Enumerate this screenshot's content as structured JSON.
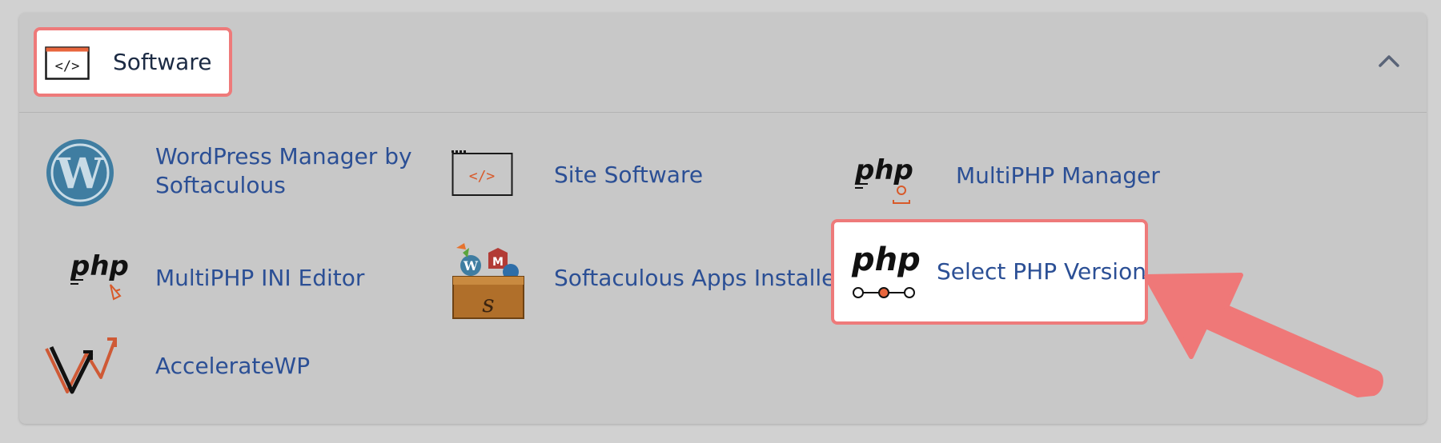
{
  "section": {
    "title": "Software",
    "title_icon": "code-window-icon",
    "collapse_icon": "chevron-up-icon"
  },
  "items": [
    {
      "label_line1": "WordPress Manager by",
      "label_line2": "Softaculous",
      "icon": "wordpress-icon"
    },
    {
      "label": "Site Software",
      "icon": "code-window-icon"
    },
    {
      "label": "MultiPHP Manager",
      "icon": "php-manager-icon"
    },
    {
      "label": "MultiPHP INI Editor",
      "icon": "php-editor-icon"
    },
    {
      "label": "Softaculous Apps Installer",
      "icon": "softaculous-box-icon"
    },
    {
      "label": "Select PHP Version",
      "icon": "php-version-icon"
    },
    {
      "label": "AccelerateWP",
      "icon": "acceleratewp-icon"
    }
  ],
  "colors": {
    "link": "#2b4f95",
    "highlight_border": "#ee7a7a",
    "arrow": "#ef7878",
    "panel_bg": "#c8c8c8"
  }
}
